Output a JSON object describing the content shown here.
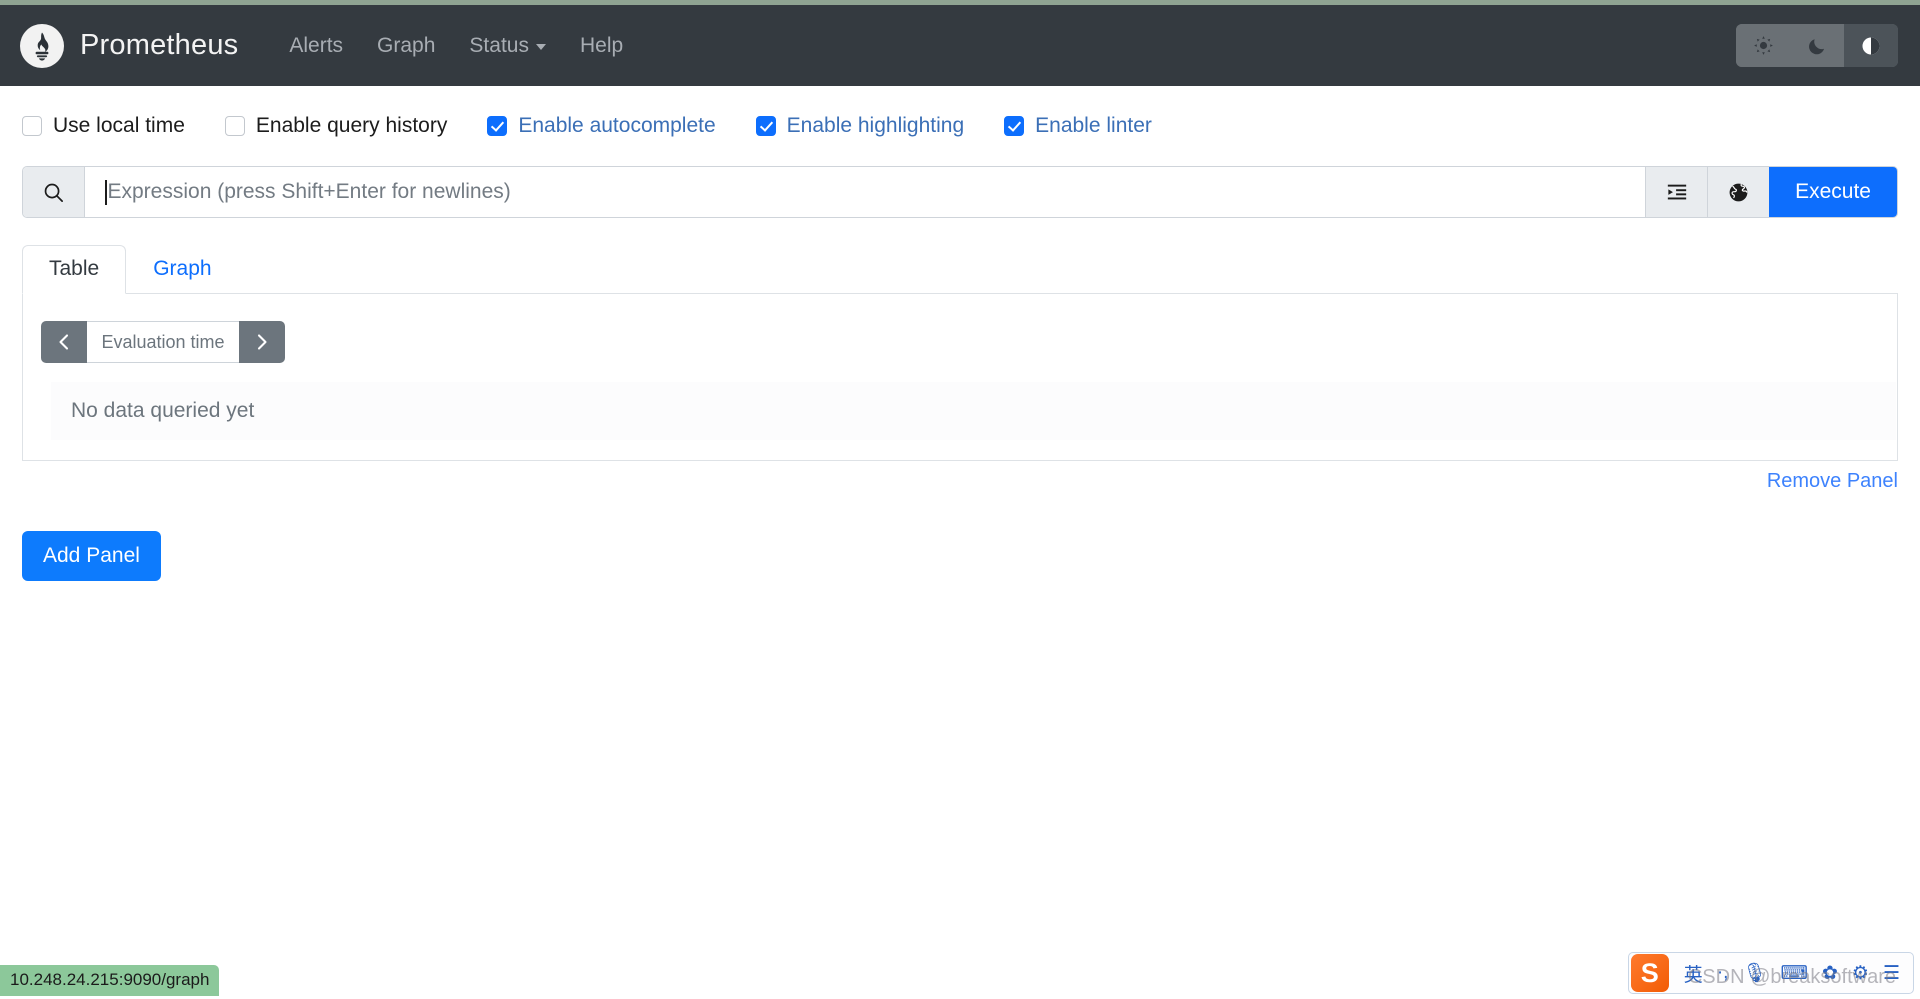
{
  "navbar": {
    "logo_icon": "prometheus-torch-icon",
    "brand": "Prometheus",
    "links": [
      {
        "label": "Alerts",
        "has_caret": false
      },
      {
        "label": "Graph",
        "has_caret": false
      },
      {
        "label": "Status",
        "has_caret": true
      },
      {
        "label": "Help",
        "has_caret": false
      }
    ],
    "theme_buttons": [
      {
        "name": "light-theme",
        "icon": "sun-icon",
        "active": false
      },
      {
        "name": "dark-theme",
        "icon": "moon-icon",
        "active": false
      },
      {
        "name": "auto-theme",
        "icon": "half-circle-icon",
        "active": true
      }
    ],
    "colors": {
      "background": "#343a40",
      "link": "#a8adb3",
      "brand": "#f3f3f3"
    }
  },
  "options": [
    {
      "label": "Use local time",
      "checked": false
    },
    {
      "label": "Enable query history",
      "checked": false
    },
    {
      "label": "Enable autocomplete",
      "checked": true
    },
    {
      "label": "Enable highlighting",
      "checked": true
    },
    {
      "label": "Enable linter",
      "checked": true
    }
  ],
  "expression": {
    "search_icon": "magnifier-icon",
    "value": "",
    "placeholder": "Expression (press Shift+Enter for newlines)",
    "format_icon": "indent-format-icon",
    "metrics_explorer_icon": "globe-icon",
    "execute_label": "Execute",
    "execute_color": "#0d6efd"
  },
  "panel": {
    "tabs": [
      {
        "label": "Table",
        "active": true
      },
      {
        "label": "Graph",
        "active": false
      }
    ],
    "evaluation": {
      "prev_icon": "chevron-left-icon",
      "next_icon": "chevron-right-icon",
      "value": "",
      "placeholder": "Evaluation time"
    },
    "no_data_text": "No data queried yet",
    "remove_panel_label": "Remove Panel"
  },
  "add_panel_label": "Add Panel",
  "status_bar": {
    "url": "10.248.24.215:9090/graph",
    "background": "#8cc89a"
  },
  "ime": {
    "logo_text": "S",
    "items": [
      {
        "label": "英",
        "name": "ime-language-toggle"
      },
      {
        "label": "·,",
        "name": "ime-punctuation-toggle"
      },
      {
        "label": "🎙",
        "name": "ime-voice-input"
      },
      {
        "label": "⌨",
        "name": "ime-keyboard"
      },
      {
        "label": "✿",
        "name": "ime-emoji"
      },
      {
        "label": "⚙",
        "name": "ime-settings"
      },
      {
        "label": "☰",
        "name": "ime-menu"
      }
    ]
  },
  "watermark": {
    "text": "CSDN @breaksoftware"
  }
}
